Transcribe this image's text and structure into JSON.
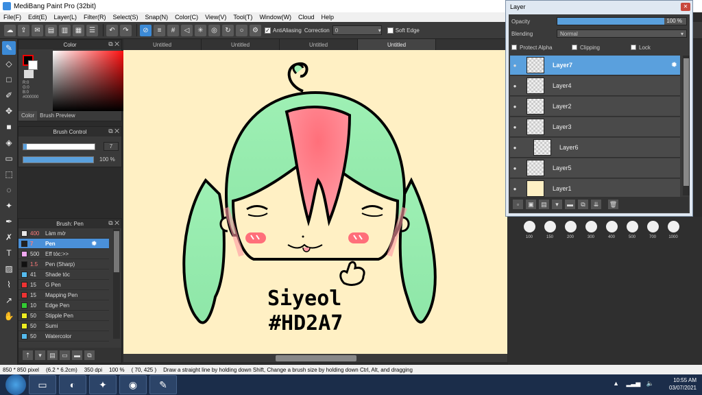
{
  "app": {
    "title": "MediBang Paint Pro (32bit)"
  },
  "menu": [
    "File(F)",
    "Edit(E)",
    "Layer(L)",
    "Filter(R)",
    "Select(S)",
    "Snap(N)",
    "Color(C)",
    "View(V)",
    "Tool(T)",
    "Window(W)",
    "Cloud",
    "Help"
  ],
  "toolbar": {
    "antialiasing_label": "AntiAliasing",
    "correction_label": "Correction",
    "correction_value": "0",
    "soft_edge_label": "Soft Edge"
  },
  "color_panel": {
    "title": "Color",
    "rgb_lines": [
      "R:0",
      "G:0",
      "B:0",
      "#000000"
    ],
    "tab_color": "Color",
    "tab_brush_preview": "Brush Preview"
  },
  "brush_control": {
    "title": "Brush Control",
    "size_value": "7",
    "size_fraction": 0.05,
    "opacity_label": "100 %",
    "opacity_fraction": 1.0
  },
  "brush_list": {
    "title": "Brush: Pen",
    "items": [
      {
        "size": "400",
        "name": "Làm mờ",
        "color": "#e8e8e8",
        "red": true
      },
      {
        "size": "7",
        "name": "Pen",
        "color": "#222222",
        "red": true,
        "selected": true
      },
      {
        "size": "500",
        "name": "Eff tóc:>>",
        "color": "#f0a8f0",
        "red": false
      },
      {
        "size": "1.5",
        "name": "Pen (Sharp)",
        "color": "#111111",
        "red": true
      },
      {
        "size": "41",
        "name": "Shade tóc",
        "color": "#55bbee",
        "red": false
      },
      {
        "size": "15",
        "name": "G Pen",
        "color": "#ee3333",
        "red": false
      },
      {
        "size": "15",
        "name": "Mapping Pen",
        "color": "#ee3333",
        "red": false
      },
      {
        "size": "10",
        "name": "Edge Pen",
        "color": "#33cc33",
        "red": false
      },
      {
        "size": "50",
        "name": "Stipple Pen",
        "color": "#eeee22",
        "red": false
      },
      {
        "size": "50",
        "name": "Sumi",
        "color": "#eeee22",
        "red": false
      },
      {
        "size": "50",
        "name": "Watercolor",
        "color": "#55bbee",
        "red": false
      }
    ]
  },
  "doc_tabs": [
    "Untitled",
    "Untitled",
    "Untitled",
    "Untitled"
  ],
  "canvas": {
    "text_line1": "Siyeol",
    "text_line2": "#HD2A7",
    "bg_color": "#fff0c4"
  },
  "layer_panel": {
    "title": "Layer",
    "opacity_label": "Opacity",
    "opacity_value": "100 %",
    "opacity_fraction": 1.0,
    "blending_label": "Blending",
    "blending_value": "Normal",
    "protect_alpha": "Protect Alpha",
    "clipping": "Clipping",
    "lock": "Lock",
    "layers": [
      {
        "name": "Layer7",
        "selected": true
      },
      {
        "name": "Layer4"
      },
      {
        "name": "Layer2"
      },
      {
        "name": "Layer3"
      },
      {
        "name": "Layer6",
        "indent": true
      },
      {
        "name": "Layer5"
      },
      {
        "name": "Layer1",
        "yellow": true
      }
    ]
  },
  "brush_sizes": [
    "100",
    "150",
    "200",
    "300",
    "400",
    "500",
    "700",
    "1000"
  ],
  "status": {
    "size": "850 * 850 pixel",
    "cm": "(6.2 * 6.2cm)",
    "dpi": "350 dpi",
    "zoom": "100 %",
    "coords": "( 70, 425 )",
    "hint": "Draw a straight line by holding down Shift, Change a brush size by holding down Ctrl, Alt, and dragging"
  },
  "taskbar": {
    "time": "10:55 AM",
    "date": "03/07/2021"
  }
}
